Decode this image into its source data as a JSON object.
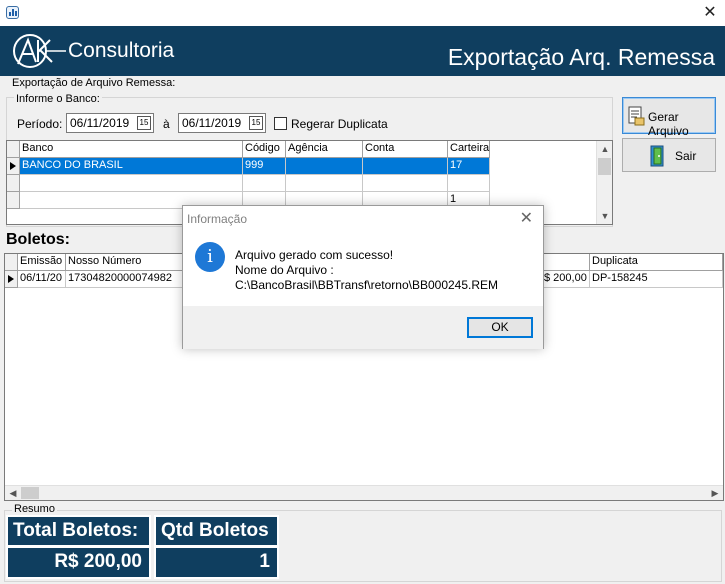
{
  "window": {
    "close_glyph": "✕"
  },
  "banner": {
    "brand": "Consultoria",
    "title": "Exportação Arq. Remessa",
    "logo_text": "AK"
  },
  "export_group": {
    "legend": "Exportação de Arquivo Remessa:",
    "bank_legend": "Informe o Banco:",
    "period_label": "Período:",
    "date_from": "06/11/2019",
    "date_to": "06/11/2019",
    "between_label": "à",
    "calendar_label": "15",
    "regerar_label": "Regerar Duplicata"
  },
  "buttons": {
    "generate": "Gerar Arquivo",
    "exit": "Sair"
  },
  "bank_grid": {
    "headers": [
      "Banco",
      "Código",
      "Agência",
      "Conta",
      "Carteira"
    ],
    "rows": [
      {
        "banco": "BANCO DO BRASIL",
        "codigo": "999",
        "agencia": "",
        "conta": "",
        "carteira": "17"
      },
      {
        "banco": "",
        "codigo": "",
        "agencia": "",
        "conta": "",
        "carteira": ""
      },
      {
        "banco": "",
        "codigo": "",
        "agencia": "",
        "conta": "",
        "carteira": "1"
      }
    ]
  },
  "boletos": {
    "title": "Boletos:",
    "headers": {
      "emissao": "Emissão",
      "nosso_numero": "Nosso Número",
      "duplicata": "Duplicata"
    },
    "rows": [
      {
        "emissao": "06/11/20",
        "nosso_numero": "17304820000074982",
        "valor": "$ 200,00",
        "duplicata": "DP-158245"
      }
    ]
  },
  "resumo": {
    "legend": "Resumo",
    "total_label": "Total Boletos:",
    "total_value": "R$ 200,00",
    "qtd_label": "Qtd Boletos",
    "qtd_value": "1"
  },
  "dialog": {
    "title": "Informação",
    "close_glyph": "✕",
    "icon_glyph": "i",
    "line1": "Arquivo gerado com sucesso!",
    "line2": "Nome do Arquivo :",
    "line3": "C:\\BancoBrasil\\BBTransf\\retorno\\BB000245.REM",
    "ok_label": "OK"
  },
  "colors": {
    "banner": "#0f3e5f",
    "selection": "#0078d7",
    "info_icon": "#1e78d6"
  }
}
